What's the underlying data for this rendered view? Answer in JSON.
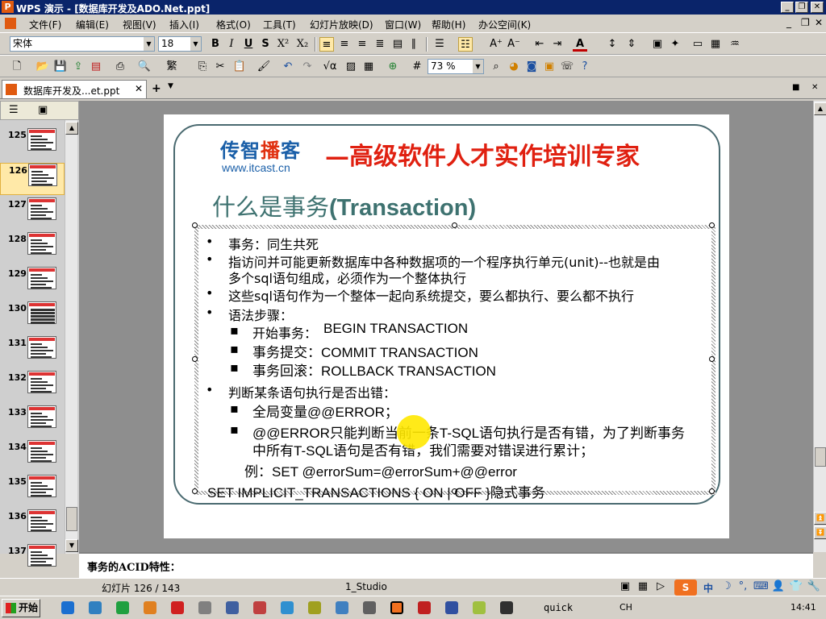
{
  "window": {
    "title": "WPS 演示 - [数据库开发及ADO.Net.ppt]",
    "app_icon": "P"
  },
  "menu": [
    "文件(F)",
    "编辑(E)",
    "视图(V)",
    "插入(I)",
    "格式(O)",
    "工具(T)",
    "幻灯片放映(D)",
    "窗口(W)",
    "帮助(H)",
    "办公空间(K)"
  ],
  "format_toolbar": {
    "font": "宋体",
    "size": "18"
  },
  "standard_toolbar": {
    "zoom": "73 %"
  },
  "tab": {
    "label": "数据库开发及...et.ppt",
    "add_label": "+"
  },
  "thumbnails": [
    {
      "num": "125"
    },
    {
      "num": "126"
    },
    {
      "num": "127"
    },
    {
      "num": "128"
    },
    {
      "num": "129"
    },
    {
      "num": "130"
    },
    {
      "num": "131"
    },
    {
      "num": "132"
    },
    {
      "num": "133"
    },
    {
      "num": "134"
    },
    {
      "num": "135"
    },
    {
      "num": "136"
    },
    {
      "num": "137"
    }
  ],
  "selected_slide": "126",
  "slide": {
    "logo_cn_a": "传智",
    "logo_cn_b": "播",
    "logo_cn_c": "客",
    "logo_url": "www.itcast.cn",
    "slogan": "—高级软件人才实作培训专家",
    "title_cn": "什么是事务",
    "title_en": "(Transaction)",
    "bullets": [
      "事务：同生共死",
      "指访问并可能更新数据库中各种数据项的一个程序执行单元(unit)--也就是由",
      "多个sql语句组成，必须作为一个整体执行",
      "这些sql语句作为一个整体一起向系统提交，要么都执行、要么都不执行",
      "语法步骤：",
      "开始事务：",
      "BEGIN TRANSACTION",
      "事务提交：COMMIT TRANSACTION",
      "事务回滚：ROLLBACK TRANSACTION",
      "判断某条语句执行是否出错：",
      "全局变量@@ERROR；",
      "@@ERROR只能判断当前一条T-SQL语句执行是否有错，为了判断事务",
      "中所有T-SQL语句是否有错，我们需要对错误进行累计；",
      "例：SET @errorSum=@errorSum+@@error",
      "SET IMPLICIT_TRANSACTIONS { ON | OFF }隐式事务"
    ]
  },
  "notes": {
    "text": "事务的ACID特性："
  },
  "status": {
    "slide_counter": "幻灯片 126 / 143",
    "template": "1_Studio"
  },
  "taskbar": {
    "start": "开始",
    "quick": "quick",
    "clock": "14:41",
    "ime": "CH"
  }
}
